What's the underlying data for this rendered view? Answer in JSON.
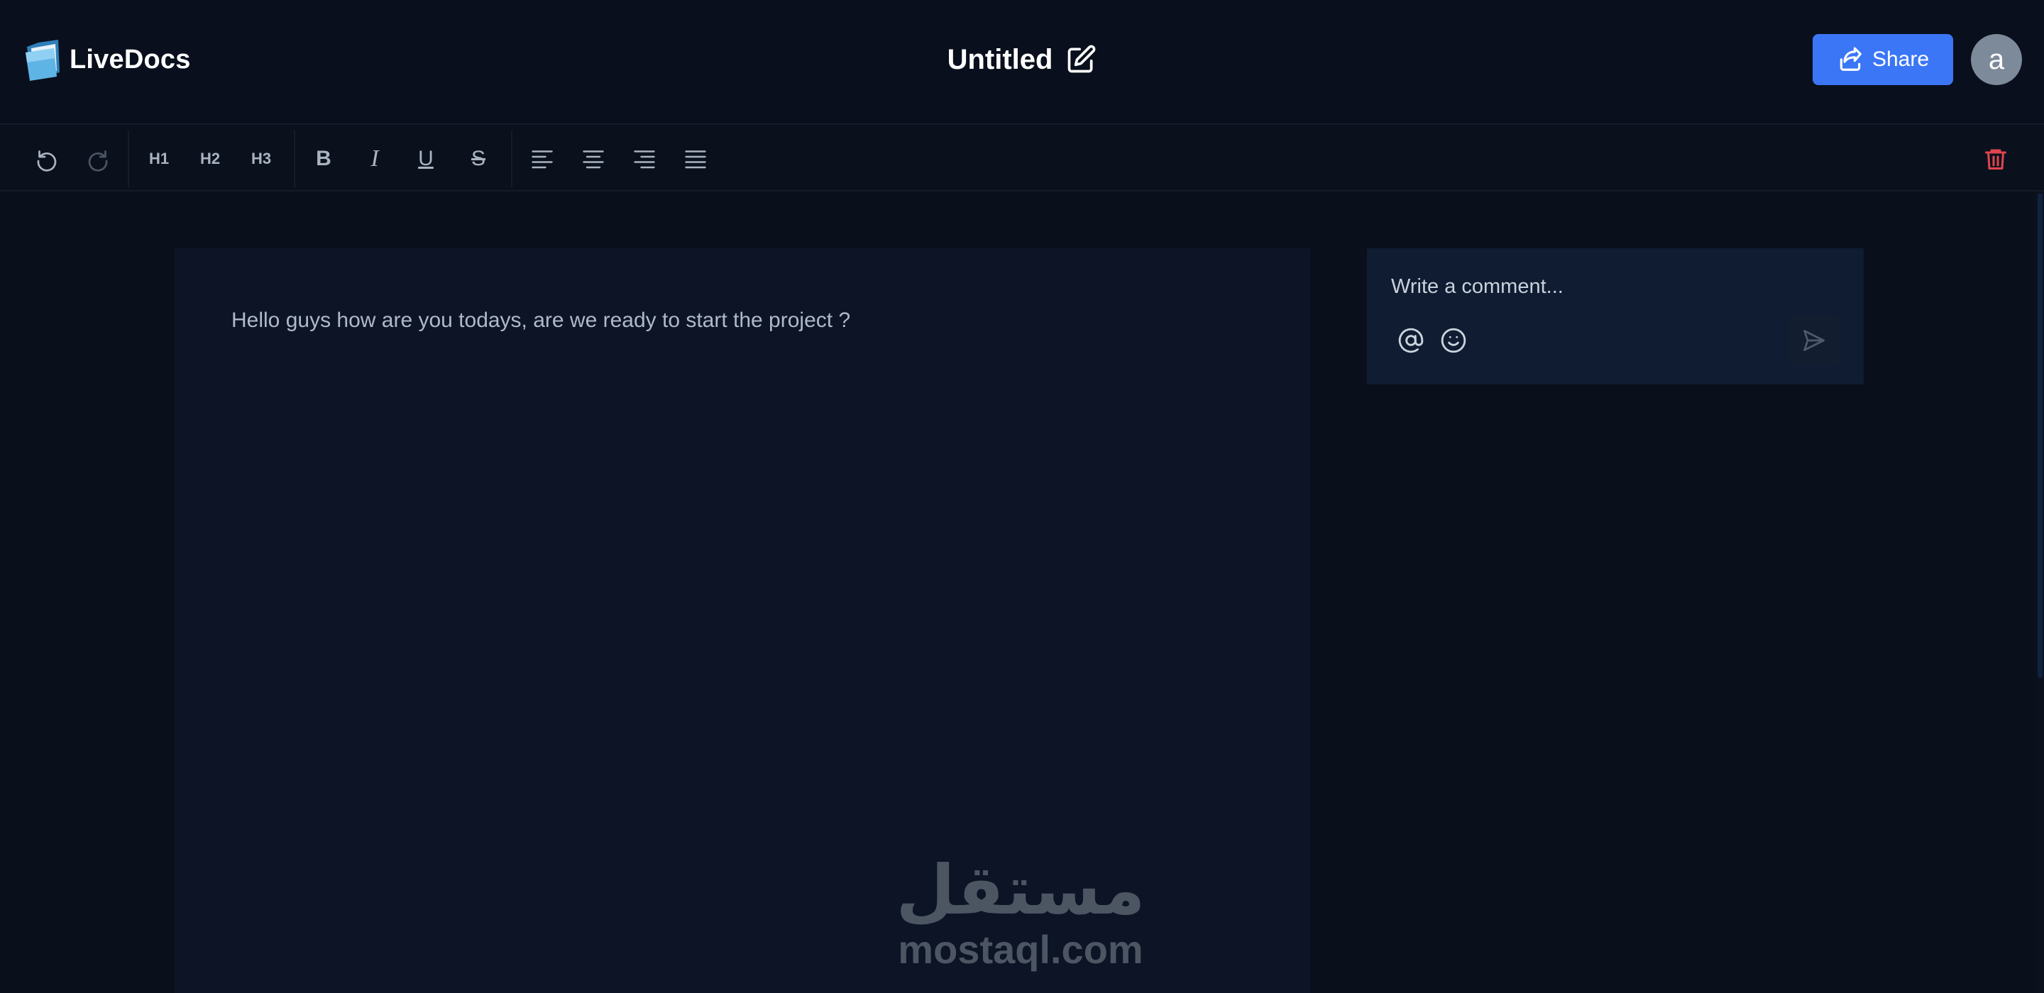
{
  "app": {
    "name": "LiveDocs",
    "logo_icon": "folder-logo-icon"
  },
  "header": {
    "doc_title": "Untitled",
    "edit_icon": "edit-icon",
    "share_label": "Share",
    "share_icon": "share-icon",
    "avatar_initial": "a"
  },
  "toolbar": {
    "undo_icon": "undo-icon",
    "redo_icon": "redo-icon",
    "h1": "H1",
    "h2": "H2",
    "h3": "H3",
    "bold": "B",
    "italic": "I",
    "underline": "U",
    "strike": "S",
    "align_icons": [
      "align-left-icon",
      "align-center-icon",
      "align-right-icon",
      "align-justify-icon"
    ],
    "delete_icon": "trash-icon"
  },
  "editor": {
    "content": "Hello guys how are you todays, are we ready to start the project ?"
  },
  "comments": {
    "placeholder": "Write a comment...",
    "mention_icon": "at-icon",
    "emoji_icon": "smiley-icon",
    "send_icon": "send-icon"
  },
  "watermark": {
    "arabic": "مستقل",
    "latin": "mostaql.com"
  },
  "colors": {
    "background": "#090f1b",
    "accent": "#3b76f6",
    "danger": "#e0454d",
    "editor_bg": "#0c1426",
    "comment_bg": "#0f1c31"
  }
}
